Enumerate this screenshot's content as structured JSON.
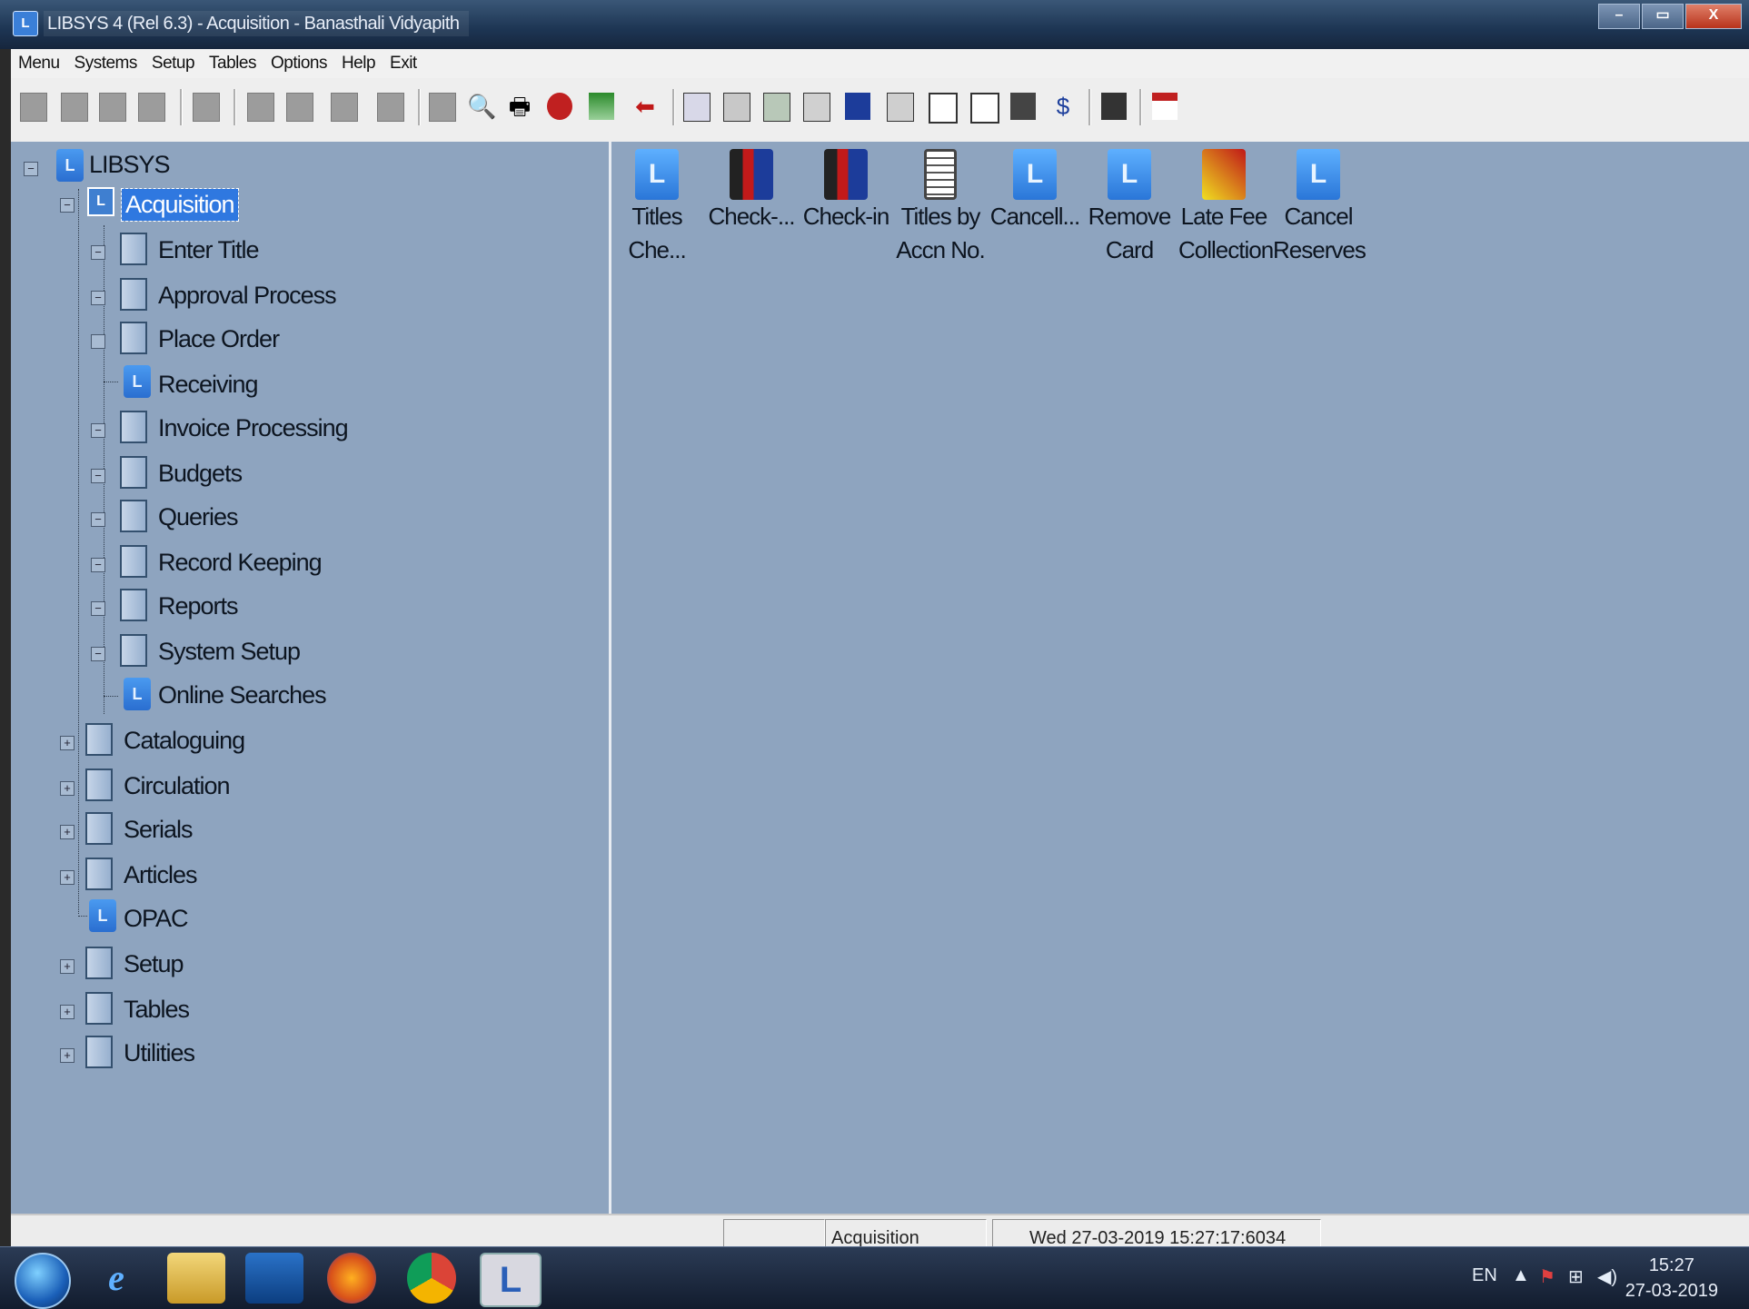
{
  "window": {
    "title": "LIBSYS 4 (Rel 6.3) - Acquisition - Banasthali Vidyapith",
    "minimize": "–",
    "maximize": "▭",
    "close": "X"
  },
  "menubar": [
    "Menu",
    "Systems",
    "Setup",
    "Tables",
    "Options",
    "Help",
    "Exit"
  ],
  "tree": {
    "root": "LIBSYS",
    "acquisition": "Acquisition",
    "acq_children": [
      "Enter Title",
      "Approval Process",
      "Place Order",
      "Receiving",
      "Invoice Processing",
      "Budgets",
      "Queries",
      "Record Keeping",
      "Reports",
      "System Setup",
      "Online Searches"
    ],
    "modules": [
      "Cataloguing",
      "Circulation",
      "Serials",
      "Articles",
      "OPAC",
      "Setup",
      "Tables",
      "Utilities"
    ]
  },
  "shortcuts": [
    {
      "line1": "Titles",
      "line2": "Che...",
      "icon": "ls"
    },
    {
      "line1": "Check-...",
      "line2": "",
      "icon": "books"
    },
    {
      "line1": "Check-in",
      "line2": "",
      "icon": "books"
    },
    {
      "line1": "Titles by",
      "line2": "Accn No.",
      "icon": "doc"
    },
    {
      "line1": "Cancell...",
      "line2": "",
      "icon": "ls"
    },
    {
      "line1": "Remove",
      "line2": "Card",
      "icon": "ls"
    },
    {
      "line1": "Late Fee",
      "line2": "Collection",
      "icon": "fee"
    },
    {
      "line1": "Cancel",
      "line2": "Reserves",
      "icon": "ls"
    }
  ],
  "status": {
    "module": "Acquisition",
    "datetime": "Wed 27-03-2019 15:27:17:6034"
  },
  "taskbar": {
    "language": "EN",
    "time": "15:27",
    "date": "27-03-2019"
  },
  "colors": {
    "pane_bg": "#8ea4bf",
    "selection": "#2f78e0"
  }
}
